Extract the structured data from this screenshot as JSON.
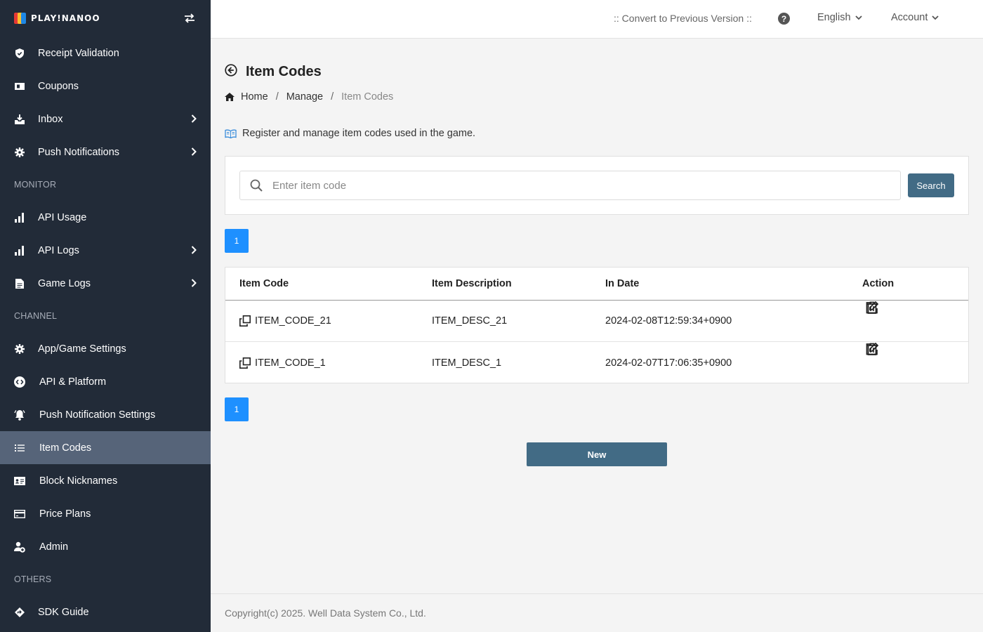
{
  "brand": {
    "name": "PLAY!NANOO",
    "logo_colors": [
      "#e53935",
      "#1e88e5",
      "#fbc02d"
    ]
  },
  "sidebar": {
    "items": [
      {
        "label": "Receipt Validation",
        "icon": "shield-check-icon"
      },
      {
        "label": "Coupons",
        "icon": "ticket-icon"
      },
      {
        "label": "Inbox",
        "icon": "inbox-download-icon",
        "has_children": true
      },
      {
        "label": "Push Notifications",
        "icon": "gear-icon",
        "has_children": true
      }
    ],
    "section_monitor": "MONITOR",
    "monitor_items": [
      {
        "label": "API Usage",
        "icon": "bar-chart-icon"
      },
      {
        "label": "API Logs",
        "icon": "bar-chart-icon",
        "has_children": true
      },
      {
        "label": "Game Logs",
        "icon": "document-icon",
        "has_children": true
      }
    ],
    "section_channel": "CHANNEL",
    "channel_items": [
      {
        "label": "App/Game Settings",
        "icon": "gear-icon"
      },
      {
        "label": "API & Platform",
        "icon": "code-circle-icon"
      },
      {
        "label": "Push Notification Settings",
        "icon": "bell-ring-icon"
      },
      {
        "label": "Item Codes",
        "icon": "list-icon",
        "active": true
      },
      {
        "label": "Block Nicknames",
        "icon": "id-card-icon"
      },
      {
        "label": "Price Plans",
        "icon": "credit-card-icon"
      },
      {
        "label": "Admin",
        "icon": "user-plus-icon"
      }
    ],
    "section_others": "OTHERS",
    "others_items": [
      {
        "label": "SDK Guide",
        "icon": "diamond-arrow-icon"
      }
    ],
    "active_color": "#566479"
  },
  "header": {
    "convert_label": ":: Convert to Previous Version ::",
    "help_label": "?",
    "language": "English",
    "account": "Account"
  },
  "page": {
    "title": "Item Codes",
    "breadcrumb": [
      "Home",
      "Manage",
      "Item Codes"
    ],
    "breadcrumb_sep": "/",
    "description": "Register and manage item codes used in the game."
  },
  "search": {
    "placeholder": "Enter item code",
    "value": "",
    "button_label": "Search"
  },
  "pagination": {
    "current_page": "1"
  },
  "table": {
    "columns": [
      "Item Code",
      "Item Description",
      "In Date",
      "Action"
    ],
    "rows": [
      {
        "code": "ITEM_CODE_21",
        "description": "ITEM_DESC_21",
        "in_date": "2024-02-08T12:59:34+0900"
      },
      {
        "code": "ITEM_CODE_1",
        "description": "ITEM_DESC_1",
        "in_date": "2024-02-07T17:06:35+0900"
      }
    ]
  },
  "new_button_label": "New",
  "footer": {
    "copyright": "Copyright(c) 2025. Well Data System Co., Ltd."
  },
  "colors": {
    "sidebar_bg": "#222b38",
    "primary_button": "#426b85",
    "pagination": "#1e90ff"
  }
}
